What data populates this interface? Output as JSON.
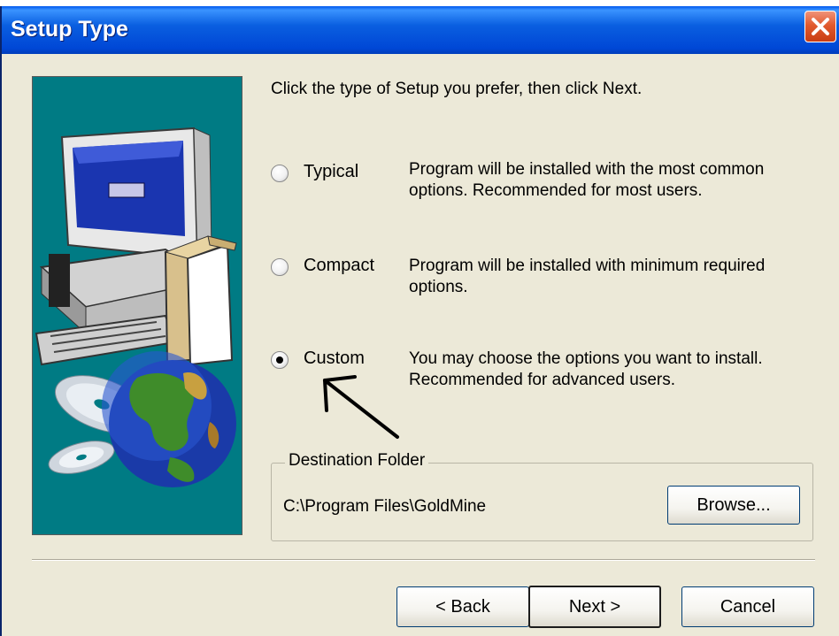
{
  "window": {
    "title": "Setup Type"
  },
  "intro_text": "Click the type of Setup you prefer, then click Next.",
  "options": [
    {
      "label": "Typical",
      "description_lines": [
        "Program will be installed with the most common",
        "options. Recommended for most users."
      ],
      "selected": false
    },
    {
      "label": "Compact",
      "description_lines": [
        "Program will be installed with minimum required",
        "options."
      ],
      "selected": false
    },
    {
      "label": "Custom",
      "description_lines": [
        "You may choose the options you want to install.",
        "Recommended for advanced users."
      ],
      "selected": true
    }
  ],
  "destination": {
    "group_label": "Destination Folder",
    "path": "C:\\Program Files\\GoldMine",
    "browse_label": "Browse..."
  },
  "buttons": {
    "back": "< Back",
    "next": "Next >",
    "cancel": "Cancel"
  },
  "icons": [
    "close-icon",
    "computer-icon",
    "cd-icon",
    "globe-icon",
    "arrow-annotation"
  ],
  "colors": {
    "title_bar": "#0054e3",
    "art_panel": "#007b84",
    "dialog_bg": "#ece9d8",
    "close_button": "#e15a2e"
  }
}
